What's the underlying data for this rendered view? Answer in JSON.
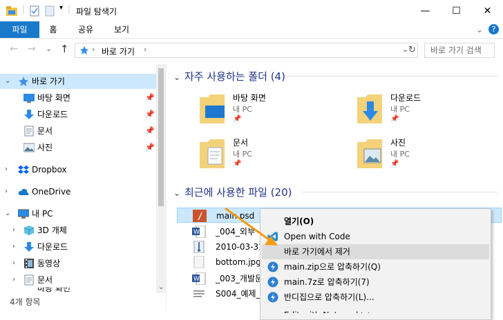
{
  "window": {
    "title": "파일 탐색기",
    "minimize": "—",
    "maximize": "☐",
    "close": "✕"
  },
  "ribbon": {
    "tabs": [
      "파일",
      "홈",
      "공유",
      "보기"
    ],
    "collapse": "⌄",
    "help": "?"
  },
  "address": {
    "back": "←",
    "forward": "→",
    "recent": "⌄",
    "up": "↑",
    "path": "바로 가기",
    "path_sep": "›",
    "path_dropdown": "⌄",
    "refresh": "↻",
    "search_placeholder": "바로 가기 검색"
  },
  "nav": {
    "quick_access": "바로 가기",
    "quick_items": [
      {
        "label": "바탕 화면",
        "icon": "desktop-folder-icon"
      },
      {
        "label": "다운로드",
        "icon": "download-folder-icon"
      },
      {
        "label": "문서",
        "icon": "documents-folder-icon"
      },
      {
        "label": "사진",
        "icon": "pictures-folder-icon"
      }
    ],
    "pin": "📌",
    "dropbox": "Dropbox",
    "onedrive": "OneDrive",
    "this_pc": "내 PC",
    "pc_items": [
      {
        "label": "3D 개체",
        "icon": "3d-objects-icon"
      },
      {
        "label": "다운로드",
        "icon": "download-folder-icon"
      },
      {
        "label": "동영상",
        "icon": "videos-folder-icon"
      },
      {
        "label": "문서",
        "icon": "documents-folder-icon"
      },
      {
        "label": "바탕 화면",
        "icon": "desktop-folder-icon"
      }
    ]
  },
  "status": {
    "item_count": "4개 항목"
  },
  "content": {
    "frequent_header": "자주 사용하는 폴더 (4)",
    "frequent": [
      {
        "name": "바탕 화면",
        "sub": "내 PC"
      },
      {
        "name": "다운로드",
        "sub": "내 PC"
      },
      {
        "name": "문서",
        "sub": "내 PC"
      },
      {
        "name": "사진",
        "sub": "내 PC"
      }
    ],
    "recent_header": "최근에 사용한 파일 (20)",
    "recent": [
      {
        "name": "main.psd"
      },
      {
        "name": "_004_외부"
      },
      {
        "name": "2010-03-31"
      },
      {
        "name": "bottom.jpg"
      },
      {
        "name": "_003_개발문"
      },
      {
        "name": "S004_예제_"
      }
    ]
  },
  "menu": {
    "items": [
      {
        "label": "열기(O)",
        "bold": true
      },
      {
        "label": "Open with Code"
      },
      {
        "label": "바로 가기에서 제거"
      },
      {
        "label": "main.zip으로 압축하기(Q)"
      },
      {
        "label": "main.7z로 압축하기(7)"
      },
      {
        "label": "반디집으로 압축하기(L)..."
      },
      {
        "label": "Edit with Notepad++"
      }
    ]
  },
  "colors": {
    "accent": "#1979ca",
    "selection": "#cce8ff",
    "group_header": "#1e3287",
    "arrow": "#f39c12"
  }
}
